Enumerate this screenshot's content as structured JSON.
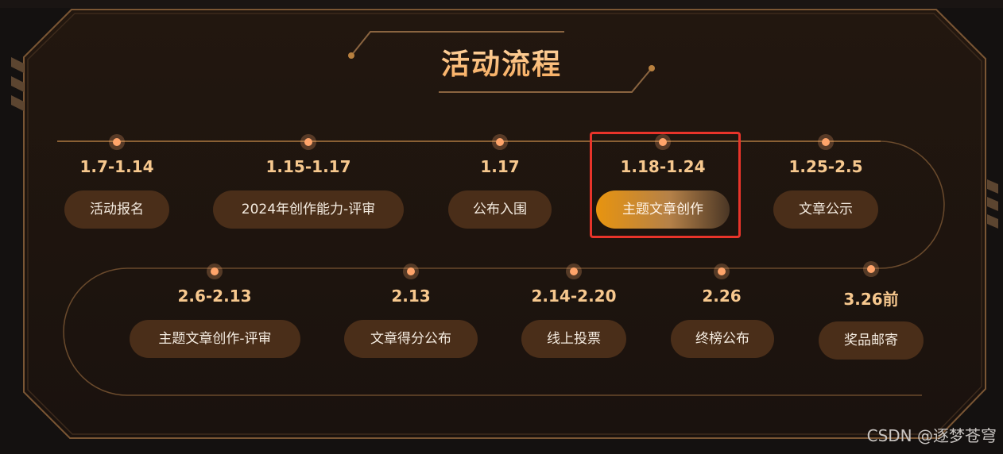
{
  "title": "活动流程",
  "row1": [
    {
      "date": "1.7-1.14",
      "label": "活动报名"
    },
    {
      "date": "1.15-1.17",
      "label": "2024年创作能力-评审"
    },
    {
      "date": "1.17",
      "label": "公布入围"
    },
    {
      "date": "1.18-1.24",
      "label": "主题文章创作",
      "active": true
    },
    {
      "date": "1.25-2.5",
      "label": "文章公示"
    }
  ],
  "row2": [
    {
      "date": "2.6-2.13",
      "label": "主题文章创作-评审"
    },
    {
      "date": "2.13",
      "label": "文章得分公布"
    },
    {
      "date": "2.14-2.20",
      "label": "线上投票"
    },
    {
      "date": "2.26",
      "label": "终榜公布"
    },
    {
      "date": "3.26前",
      "label": "奖品邮寄"
    }
  ],
  "watermark": "CSDN @逐梦苍穹",
  "colors": {
    "background": "#141110",
    "panel": "#1f1612",
    "pill": "#4a2e19",
    "accent": "#ffa46a",
    "date_text": "#f7c88e",
    "highlight": "#e8342a"
  }
}
